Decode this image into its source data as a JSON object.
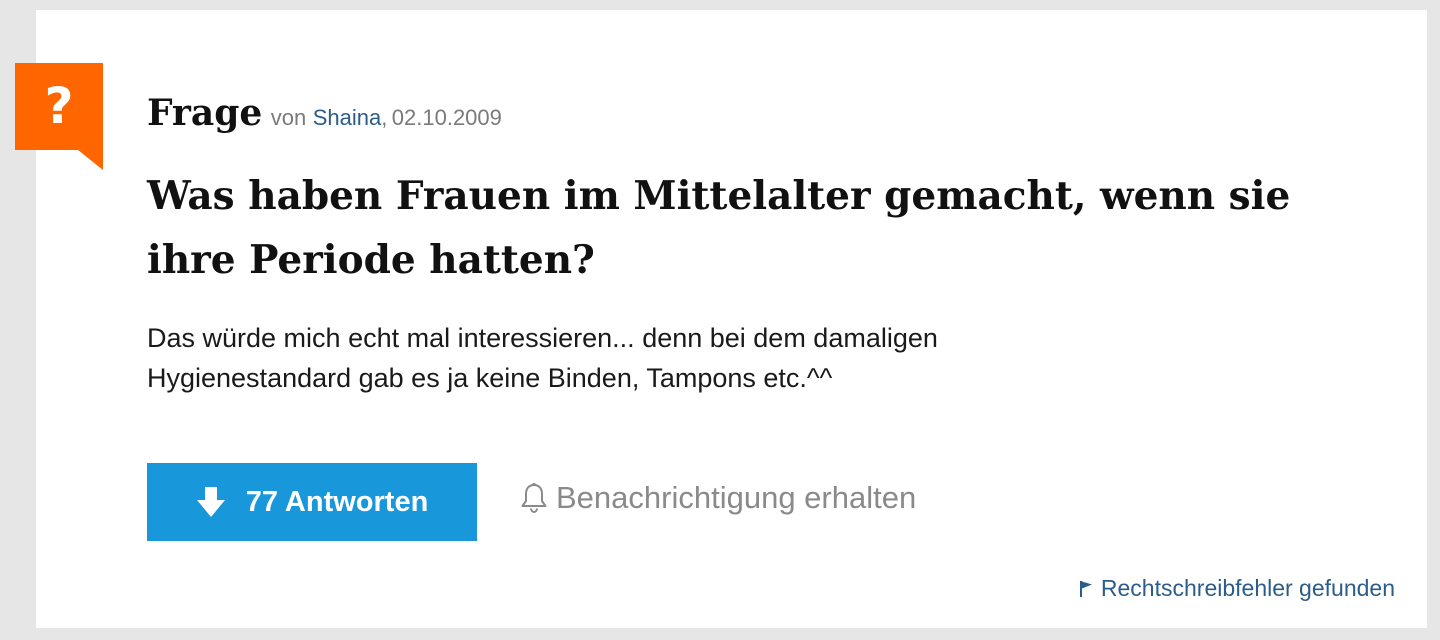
{
  "question": {
    "badge_symbol": "?",
    "label": "Frage",
    "by_prefix": "von",
    "author": "Shaina",
    "date_separator": ",",
    "date": "02.10.2009",
    "title": "Was haben Frauen im Mittelalter gemacht, wenn sie ihre Periode hatten?",
    "body": "Das würde mich echt mal interessieren... denn bei dem damaligen Hygienestandard gab es ja keine Binden, Tampons etc.^^"
  },
  "actions": {
    "answers_button_label": "77 Antworten",
    "answers_icon": "arrow-down-icon",
    "notify_label": "Benachrichtigung erhalten",
    "notify_icon": "bell-icon",
    "report_label": "Rechtschreibfehler gefunden",
    "report_icon": "flag-icon"
  },
  "colors": {
    "badge": "#ff6600",
    "primary_button": "#1997db",
    "link": "#2c5d8a",
    "muted": "#7a7a7a",
    "background": "#e6e6e6"
  }
}
